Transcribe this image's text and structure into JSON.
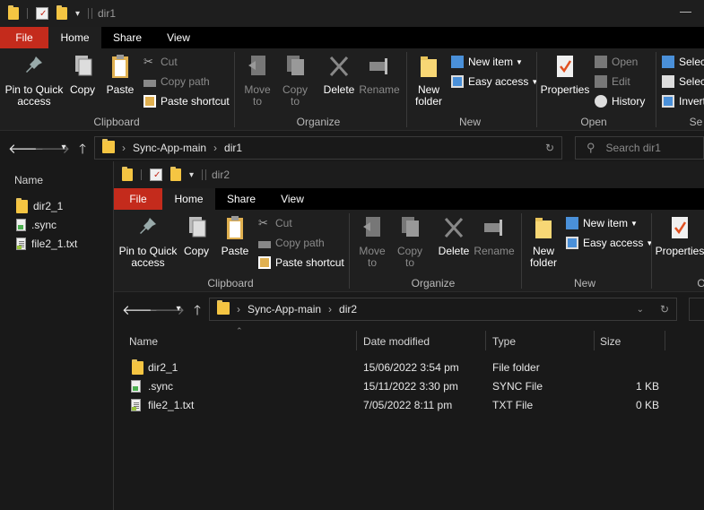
{
  "back_window": {
    "title": "dir1",
    "tabs": [
      "File",
      "Home",
      "Share",
      "View"
    ],
    "clipboard": {
      "pin": "Pin to Quick access",
      "copy": "Copy",
      "paste": "Paste",
      "cut": "Cut",
      "copy_path": "Copy path",
      "paste_shortcut": "Paste shortcut",
      "label": "Clipboard"
    },
    "organize": {
      "move_to": "Move to",
      "copy_to": "Copy to",
      "delete": "Delete",
      "rename": "Rename",
      "label": "Organize"
    },
    "new": {
      "new_folder": "New folder",
      "new_item": "New item",
      "easy_access": "Easy access",
      "label": "New"
    },
    "open": {
      "properties": "Properties",
      "open": "Open",
      "edit": "Edit",
      "history": "History",
      "label": "Open"
    },
    "select": {
      "select_all": "Select",
      "select_none": "Select",
      "invert": "Invert",
      "label": "Se"
    },
    "address": {
      "crumbs": [
        "Sync-App-main",
        "dir1"
      ]
    },
    "search_placeholder": "Search dir1",
    "sidebar": {
      "header": "Name",
      "items": [
        {
          "name": "dir2_1",
          "icon": "folder-icon"
        },
        {
          "name": ".sync",
          "icon": "sync-file-icon"
        },
        {
          "name": "file2_1.txt",
          "icon": "text-file-icon"
        }
      ]
    }
  },
  "front_window": {
    "title": "dir2",
    "tabs": [
      "File",
      "Home",
      "Share",
      "View"
    ],
    "clipboard": {
      "pin": "Pin to Quick access",
      "copy": "Copy",
      "paste": "Paste",
      "cut": "Cut",
      "copy_path": "Copy path",
      "paste_shortcut": "Paste shortcut",
      "label": "Clipboard"
    },
    "organize": {
      "move_to": "Move to",
      "copy_to": "Copy to",
      "delete": "Delete",
      "rename": "Rename",
      "label": "Organize"
    },
    "new": {
      "new_folder": "New folder",
      "new_item": "New item",
      "easy_access": "Easy access",
      "label": "New"
    },
    "open": {
      "properties": "Properties",
      "label": "O"
    },
    "address": {
      "crumbs": [
        "Sync-App-main",
        "dir2"
      ]
    },
    "columns": {
      "name": "Name",
      "date": "Date modified",
      "type": "Type",
      "size": "Size"
    },
    "files": [
      {
        "name": "dir2_1",
        "date": "15/06/2022 3:54 pm",
        "type": "File folder",
        "size": ""
      },
      {
        "name": ".sync",
        "date": "15/11/2022 3:30 pm",
        "type": "SYNC File",
        "size": "1 KB"
      },
      {
        "name": "file2_1.txt",
        "date": "7/05/2022 8:11 pm",
        "type": "TXT File",
        "size": "0 KB"
      }
    ]
  },
  "colors": {
    "file_tab": "#c42b1c",
    "background": "#191919",
    "folder": "#f8d775"
  }
}
